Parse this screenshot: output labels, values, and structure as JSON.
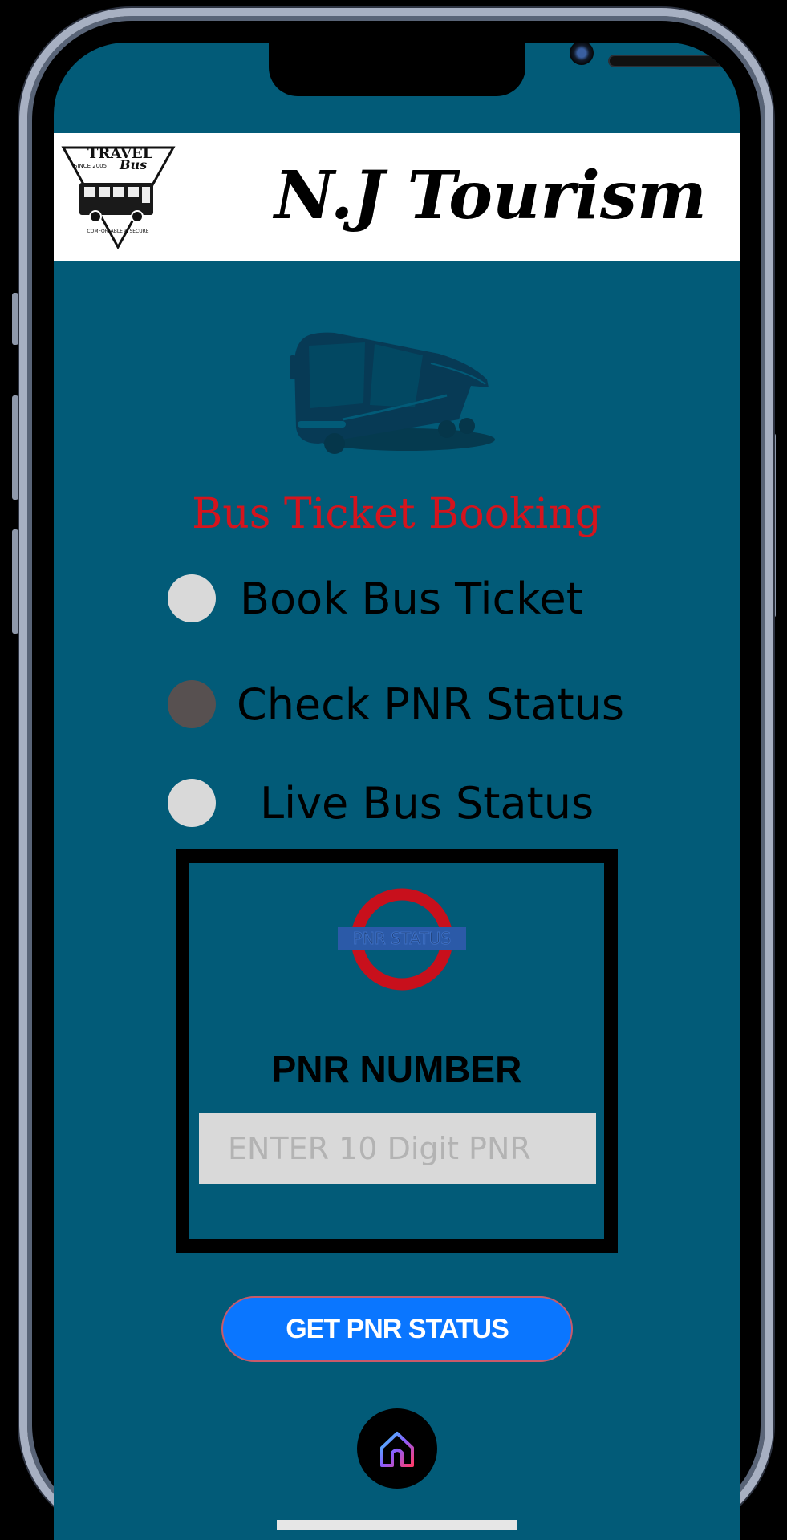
{
  "header": {
    "logo": {
      "brand_top": "TRAVEL",
      "brand_script": "Bus",
      "since": "SINCE 2005",
      "tagline": "COMFORTABLE & SECURE",
      "icon": "bus-logo-icon"
    },
    "title": "N.J Tourism"
  },
  "hero": {
    "icon": "bus-icon",
    "title": "Bus Ticket Booking"
  },
  "options": [
    {
      "label": "Book Bus Ticket",
      "selected": false
    },
    {
      "label": "Check PNR Status",
      "selected": true
    },
    {
      "label": "Live Bus Status",
      "selected": false
    }
  ],
  "pnr": {
    "badge_text": "PNR STATUS",
    "label": "PNR NUMBER",
    "input_value": "",
    "placeholder": "ENTER 10 Digit PNR",
    "submit_label": "GET PNR STATUS"
  },
  "nav": {
    "home_icon": "home-icon"
  },
  "colors": {
    "screen_bg": "#025b78",
    "title_red": "#d5141d",
    "button_blue": "#0a76ff",
    "radio_default": "#d9d9d9",
    "radio_selected": "#575050"
  }
}
